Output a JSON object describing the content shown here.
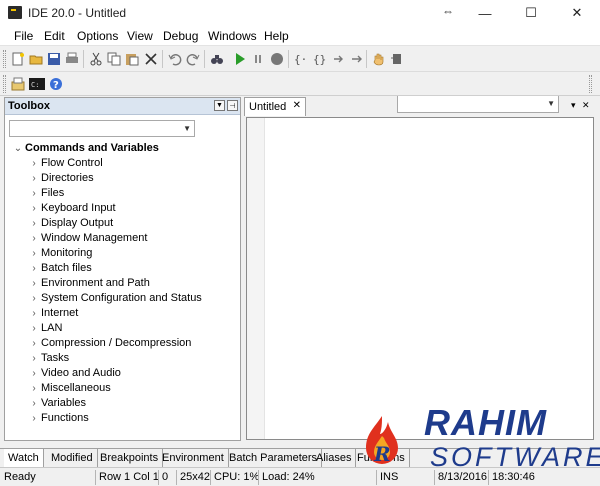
{
  "window": {
    "title": "IDE 20.0 - Untitled",
    "controls": {
      "minimize": "—",
      "maximize": "☐",
      "close": "✕"
    }
  },
  "menu": [
    "File",
    "Edit",
    "Options",
    "View",
    "Debug",
    "Windows",
    "Help"
  ],
  "toolbar": {
    "icons": [
      "new-file-icon",
      "open-folder-icon",
      "save-icon",
      "print-icon",
      "cut-icon",
      "copy-icon",
      "paste-icon",
      "delete-icon",
      "undo-icon",
      "redo-icon",
      "find-icon",
      "run-icon",
      "pause-icon",
      "stop-icon",
      "block-icon",
      "brace-icon",
      "indent-icon",
      "step-icon",
      "hand-icon",
      "breakpoint-icon"
    ],
    "combo_value": "",
    "toolbar2_icons": [
      "settings-icon",
      "console-icon",
      "help-icon"
    ],
    "combo2_value": ""
  },
  "toolbox": {
    "title": "Toolbox",
    "filter_value": "",
    "root": "Commands and Variables",
    "items": [
      "Flow Control",
      "Directories",
      "Files",
      "Keyboard Input",
      "Display Output",
      "Window Management",
      "Monitoring",
      "Batch files",
      "Environment and Path",
      "System Configuration and Status",
      "Internet",
      "LAN",
      "Compression / Decompression",
      "Tasks",
      "Video and Audio",
      "Miscellaneous",
      "Variables",
      "Functions"
    ]
  },
  "editor": {
    "tab": "Untitled",
    "tab_close": "✕",
    "dropdown_glyph": "▾",
    "close_glyph": "✕",
    "content": ""
  },
  "bottom_tabs": [
    "Watch",
    "Modified",
    "Breakpoints",
    "Environment",
    "Batch Parameters",
    "Aliases",
    "Functions"
  ],
  "status": {
    "state": "Ready",
    "position": "Row 1  Col 1",
    "col_extra": "0",
    "size": "25x42",
    "cpu": "CPU:  1%",
    "load": "Load: 24%",
    "mode": "INS",
    "date": "8/13/2016",
    "time": "18:30:46"
  },
  "watermark": {
    "name": "RAHIM",
    "sub": "SOFTWARES",
    "initial": "R"
  },
  "colors": {
    "accent_blue": "#1e3b8c",
    "flame_red": "#e0301e",
    "run_green": "#2a9d2a"
  }
}
